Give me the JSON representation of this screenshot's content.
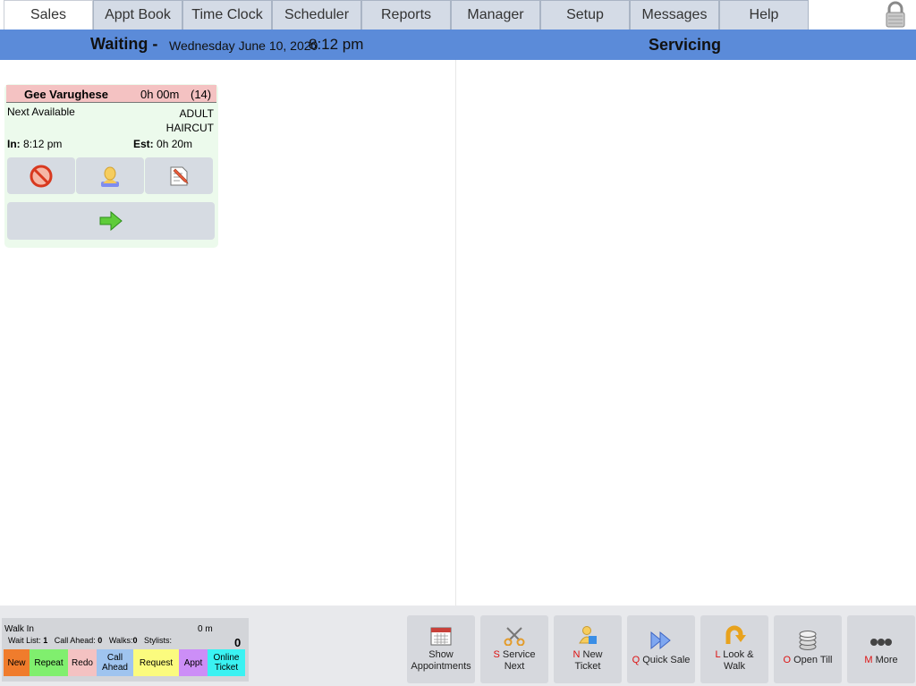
{
  "menu": {
    "tabs": [
      "Sales",
      "Appt Book",
      "Time Clock",
      "Scheduler",
      "Reports",
      "Manager",
      "Setup",
      "Messages",
      "Help"
    ],
    "active": 0
  },
  "header": {
    "waiting_label": "Waiting -",
    "date": "Wednesday June 10, 2020",
    "time": "8:12 pm",
    "servicing_label": "Servicing"
  },
  "ticket": {
    "name": "Gee Varughese",
    "elapsed": "0h 00m",
    "number": "(14)",
    "stylist": "Next Available",
    "service_line1": "ADULT",
    "service_line2": "HAIRCUT",
    "in_label": "In:",
    "in_time": "8:12 pm",
    "est_label": "Est:",
    "est_time": "0h 20m"
  },
  "status": {
    "walk_in": "Walk In",
    "minutes": "0 m",
    "wait_list_label": "Wait List:",
    "wait_list": "1",
    "call_ahead_label": "Call Ahead:",
    "call_ahead": "0",
    "walks_label": "Walks:",
    "walks": "0",
    "stylists_label": "Stylists:",
    "stylists": "0"
  },
  "legend": [
    {
      "label": "New",
      "color": "#f07c2c"
    },
    {
      "label": "Repeat",
      "color": "#80ef6e"
    },
    {
      "label": "Redo",
      "color": "#f4c2c2"
    },
    {
      "label": "Call Ahead",
      "color": "#9fc4ef"
    },
    {
      "label": "Request",
      "color": "#fbfb7e"
    },
    {
      "label": "Appt",
      "color": "#cc8ef7"
    },
    {
      "label": "Online Ticket",
      "color": "#3af2f2"
    }
  ],
  "actions": {
    "show_appointments": {
      "line1": "Show",
      "line2": "Appointments"
    },
    "service_next": {
      "key": "S",
      "line1": "Service",
      "line2": "Next"
    },
    "new_ticket": {
      "key": "N",
      "line1": "New",
      "line2": "Ticket"
    },
    "quick_sale": {
      "key": "Q",
      "line1": "Quick Sale"
    },
    "look_walk": {
      "key": "L",
      "line1": "Look &",
      "line2": "Walk"
    },
    "open_till": {
      "key": "O",
      "line1": "Open Till"
    },
    "more": {
      "key": "M",
      "line1": "More"
    }
  },
  "icons": {
    "lock": "lock-icon",
    "cancel": "no-entry-icon",
    "assign": "person-icon",
    "edit": "edit-note-icon",
    "advance": "green-arrow-icon"
  }
}
